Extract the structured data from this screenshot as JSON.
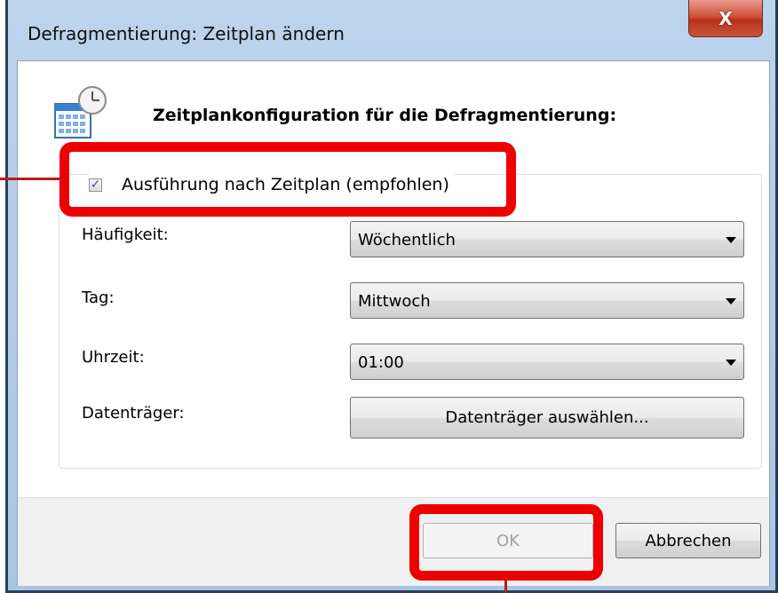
{
  "window": {
    "title": "Defragmentierung: Zeitplan ändern"
  },
  "header": {
    "heading": "Zeitplankonfiguration für die Defragmentierung:",
    "icon": "calendar-clock-icon"
  },
  "schedule": {
    "checkbox_label": "Ausführung nach Zeitplan (empfohlen)",
    "checked": true,
    "frequency": {
      "label": "Häufigkeit:",
      "value": "Wöchentlich"
    },
    "day": {
      "label": "Tag:",
      "value": "Mittwoch"
    },
    "time": {
      "label": "Uhrzeit:",
      "value": "01:00"
    },
    "disks": {
      "label": "Datenträger:",
      "button_label": "Datenträger auswählen..."
    }
  },
  "footer": {
    "ok_label": "OK",
    "cancel_label": "Abbrechen"
  },
  "colors": {
    "highlight": "#ee0000"
  }
}
